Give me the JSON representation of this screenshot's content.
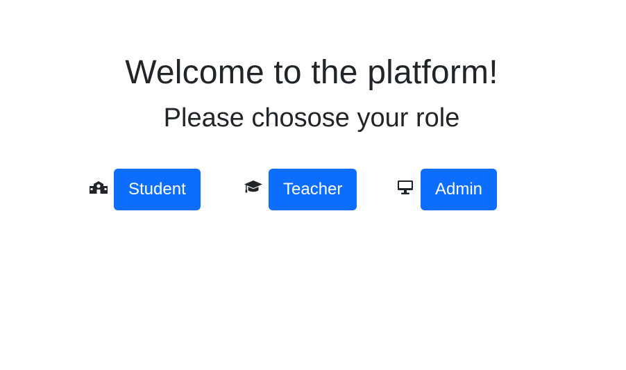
{
  "heading": {
    "title": "Welcome to the platform!",
    "subtitle": "Please chosose your role"
  },
  "roles": [
    {
      "label": "Student",
      "icon": "school-icon"
    },
    {
      "label": "Teacher",
      "icon": "graduation-cap-icon"
    },
    {
      "label": "Admin",
      "icon": "desktop-icon"
    }
  ],
  "colors": {
    "button_bg": "#0d6efd",
    "button_text": "#ffffff",
    "text": "#212529",
    "icon": "#212529"
  }
}
